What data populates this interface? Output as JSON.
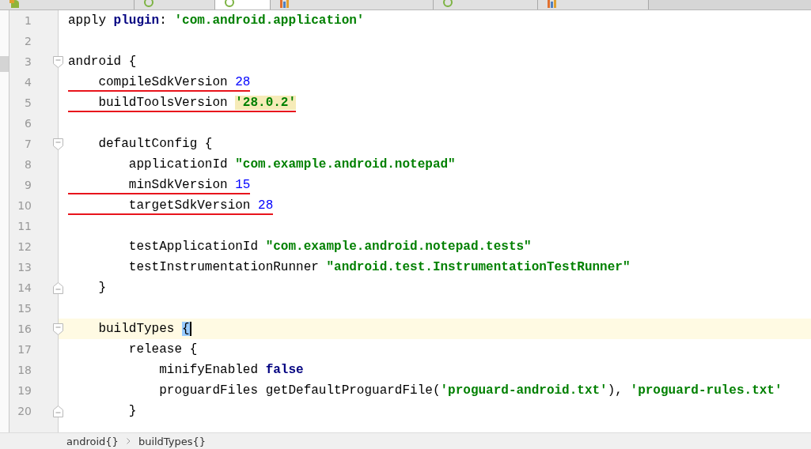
{
  "tabs": [
    {
      "kind": "android",
      "selected": false
    },
    {
      "kind": "gradle",
      "selected": false
    },
    {
      "kind": "gradle",
      "selected": true
    },
    {
      "kind": "properties",
      "selected": false
    },
    {
      "kind": "gradle",
      "selected": false
    },
    {
      "kind": "properties",
      "selected": false
    }
  ],
  "lines": [
    {
      "number": "1",
      "kind": "plain",
      "underlined": false,
      "current": false,
      "tokens": [
        {
          "text": "apply ",
          "kind": "plain"
        },
        {
          "text": "plugin",
          "kind": "keyword"
        },
        {
          "text": ": ",
          "kind": "plain"
        },
        {
          "text": "'com.android.application'",
          "kind": "string"
        }
      ]
    },
    {
      "number": "2",
      "kind": "plain",
      "current": false
    },
    {
      "number": "3",
      "kind": "fold-open",
      "underlined": false,
      "current": false,
      "tokens": [
        {
          "text": "android {",
          "kind": "plain"
        }
      ]
    },
    {
      "number": "4",
      "kind": "plain",
      "underlined": true,
      "current": false,
      "tokens": [
        {
          "text": "    compileSdkVersion ",
          "kind": "plain"
        },
        {
          "text": "28",
          "kind": "number"
        }
      ]
    },
    {
      "number": "5",
      "kind": "plain",
      "underlined": true,
      "current": false,
      "tokens": [
        {
          "text": "    buildToolsVersion ",
          "kind": "plain"
        },
        {
          "text": "'28.0.2'",
          "kind": "string",
          "highlighted": true
        }
      ]
    },
    {
      "number": "6",
      "kind": "plain",
      "current": false
    },
    {
      "number": "7",
      "kind": "fold-open",
      "underlined": false,
      "current": false,
      "tokens": [
        {
          "text": "    defaultConfig {",
          "kind": "plain"
        }
      ]
    },
    {
      "number": "8",
      "kind": "plain",
      "underlined": false,
      "current": false,
      "tokens": [
        {
          "text": "        applicationId ",
          "kind": "plain"
        },
        {
          "text": "\"com.example.android.notepad\"",
          "kind": "string"
        }
      ]
    },
    {
      "number": "9",
      "kind": "plain",
      "underlined": true,
      "current": false,
      "tokens": [
        {
          "text": "        minSdkVersion ",
          "kind": "plain"
        },
        {
          "text": "15",
          "kind": "number"
        }
      ]
    },
    {
      "number": "10",
      "kind": "plain",
      "underlined": true,
      "current": false,
      "tokens": [
        {
          "text": "        targetSdkVersion ",
          "kind": "plain"
        },
        {
          "text": "28",
          "kind": "number"
        }
      ]
    },
    {
      "number": "11",
      "kind": "plain",
      "current": false
    },
    {
      "number": "12",
      "kind": "plain",
      "underlined": false,
      "current": false,
      "tokens": [
        {
          "text": "        testApplicationId ",
          "kind": "plain"
        },
        {
          "text": "\"com.example.android.notepad.tests\"",
          "kind": "string"
        }
      ]
    },
    {
      "number": "13",
      "kind": "plain",
      "underlined": false,
      "current": false,
      "tokens": [
        {
          "text": "        testInstrumentationRunner ",
          "kind": "plain"
        },
        {
          "text": "\"android.test.InstrumentationTestRunner\"",
          "kind": "string"
        }
      ]
    },
    {
      "number": "14",
      "kind": "fold-close",
      "underlined": false,
      "current": false,
      "tokens": [
        {
          "text": "    }",
          "kind": "plain"
        }
      ]
    },
    {
      "number": "15",
      "kind": "plain",
      "current": false
    },
    {
      "number": "16",
      "kind": "fold-open",
      "underlined": false,
      "current": true,
      "tokens": [
        {
          "text": "    buildTypes ",
          "kind": "plain"
        },
        {
          "text": "{",
          "kind": "plain",
          "matched": true
        }
      ]
    },
    {
      "number": "17",
      "kind": "plain",
      "underlined": false,
      "current": false,
      "tokens": [
        {
          "text": "        release {",
          "kind": "plain"
        }
      ]
    },
    {
      "number": "18",
      "kind": "plain",
      "underlined": false,
      "current": false,
      "tokens": [
        {
          "text": "            minifyEnabled ",
          "kind": "plain"
        },
        {
          "text": "false",
          "kind": "keyword"
        }
      ]
    },
    {
      "number": "19",
      "kind": "plain",
      "underlined": false,
      "current": false,
      "tokens": [
        {
          "text": "            proguardFiles getDefaultProguardFile(",
          "kind": "plain"
        },
        {
          "text": "'proguard-android.txt'",
          "kind": "string"
        },
        {
          "text": "), ",
          "kind": "plain"
        },
        {
          "text": "'proguard-rules.txt'",
          "kind": "string"
        }
      ]
    },
    {
      "number": "20",
      "kind": "fold-close",
      "underlined": false,
      "current": false,
      "tokens": [
        {
          "text": "        }",
          "kind": "plain"
        }
      ]
    }
  ],
  "breadcrumbs": [
    "android{}",
    "buildTypes{}"
  ]
}
